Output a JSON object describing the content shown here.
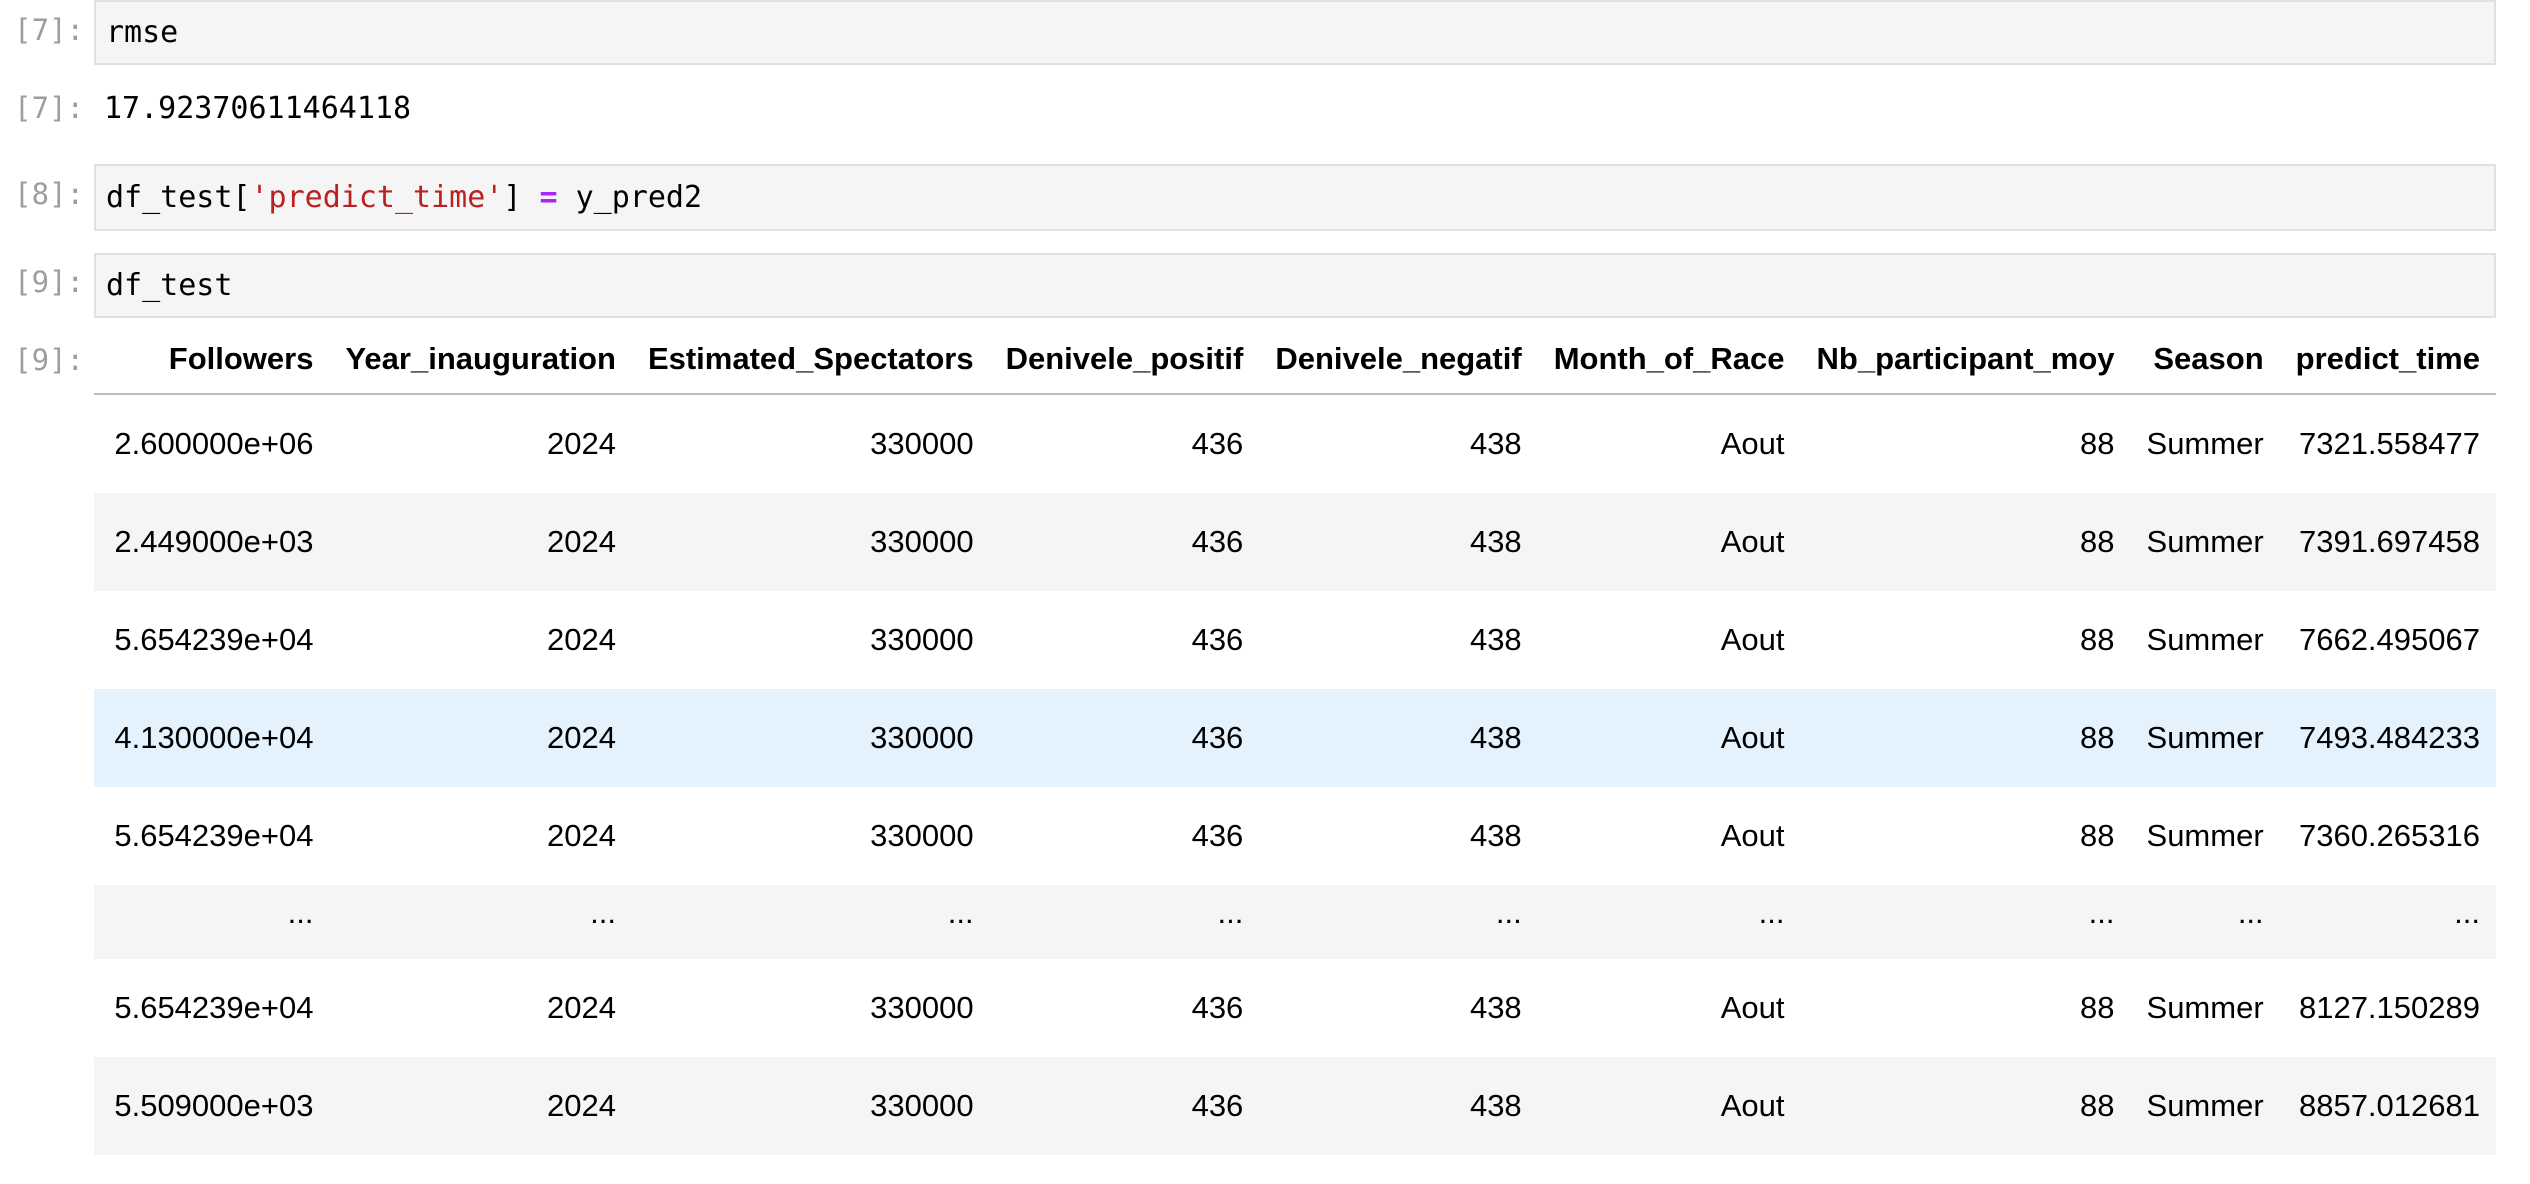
{
  "cells": {
    "c7_in": {
      "prompt": "[7]:",
      "code": "rmse"
    },
    "c7_out": {
      "prompt": "[7]:",
      "text": "17.92370611464118"
    },
    "c8_in": {
      "prompt": "[8]:",
      "code_a": "df_test[",
      "code_str": "'predict_time'",
      "code_b": "] ",
      "code_op": "=",
      "code_c": " y_pred2"
    },
    "c9_in": {
      "prompt": "[9]:",
      "code": "df_test"
    },
    "c9_out": {
      "prompt": "[9]:"
    }
  },
  "dataframe": {
    "columns": [
      "Followers",
      "Year_inauguration",
      "Estimated_Spectators",
      "Denivele_positif",
      "Denivele_negatif",
      "Month_of_Race",
      "Nb_participant_moy",
      "Season",
      "predict_time"
    ],
    "rows": [
      [
        "2.600000e+06",
        "2024",
        "330000",
        "436",
        "438",
        "Aout",
        "88",
        "Summer",
        "7321.558477"
      ],
      [
        "2.449000e+03",
        "2024",
        "330000",
        "436",
        "438",
        "Aout",
        "88",
        "Summer",
        "7391.697458"
      ],
      [
        "5.654239e+04",
        "2024",
        "330000",
        "436",
        "438",
        "Aout",
        "88",
        "Summer",
        "7662.495067"
      ],
      [
        "4.130000e+04",
        "2024",
        "330000",
        "436",
        "438",
        "Aout",
        "88",
        "Summer",
        "7493.484233"
      ],
      [
        "5.654239e+04",
        "2024",
        "330000",
        "436",
        "438",
        "Aout",
        "88",
        "Summer",
        "7360.265316"
      ],
      [
        "...",
        "...",
        "...",
        "...",
        "...",
        "...",
        "...",
        "...",
        "..."
      ],
      [
        "5.654239e+04",
        "2024",
        "330000",
        "436",
        "438",
        "Aout",
        "88",
        "Summer",
        "8127.150289"
      ],
      [
        "5.509000e+03",
        "2024",
        "330000",
        "436",
        "438",
        "Aout",
        "88",
        "Summer",
        "8857.012681"
      ]
    ],
    "highlighted_row": 3
  },
  "colors": {
    "prompt": "#9e9e9e",
    "cell_bg": "#f5f5f5",
    "cell_border": "#e0e0e0",
    "string": "#ba2121",
    "operator": "#aa22ff",
    "row_highlight": "#e3f2fd"
  }
}
